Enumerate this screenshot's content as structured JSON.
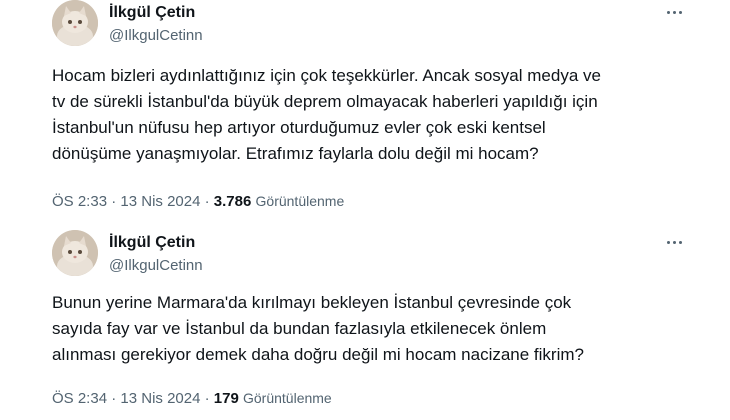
{
  "tweets": [
    {
      "display_name": "İlkgül Çetin",
      "handle": "@IlkgulCetinn",
      "body_lines": [
        "Hocam bizleri aydınlattığınız için çok teşekkürler. Ancak sosyal medya ve",
        "tv de sürekli İstanbul'da büyük deprem olmayacak haberleri yapıldığı için",
        "İstanbul'un nüfusu hep artıyor oturduğumuz evler çok eski kentsel",
        "dönüşüme yanaşmıyolar. Etrafımız faylarla dolu değil mi hocam?"
      ],
      "time": "ÖS 2:33",
      "separator": "·",
      "date": "13 Nis 2024",
      "views_count": "3.786",
      "views_label": "Görüntülenme"
    },
    {
      "display_name": "İlkgül Çetin",
      "handle": "@IlkgulCetinn",
      "body_lines": [
        "Bunun yerine Marmara'da kırılmayı bekleyen İstanbul çevresinde çok",
        "sayıda fay var ve İstanbul da bundan fazlasıyla etkilenecek önlem",
        "alınması gerekiyor demek daha doğru değil mi hocam nacizane fikrim?"
      ],
      "time": "ÖS 2:34",
      "separator": "·",
      "date": "13 Nis 2024",
      "views_count": "179",
      "views_label": "Görüntülenme"
    }
  ],
  "icons": {
    "more": "more-options-icon",
    "avatar": "cat-avatar"
  },
  "colors": {
    "text_primary": "#0f1419",
    "text_secondary": "#536471",
    "background": "#ffffff"
  }
}
